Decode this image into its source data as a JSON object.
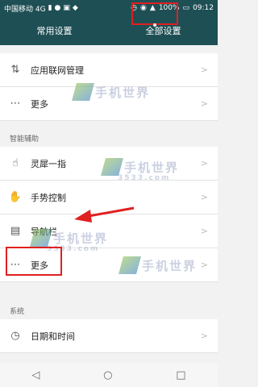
{
  "status": {
    "carrier": "中国移动 4G",
    "battery": "100%",
    "time": "09:12"
  },
  "tabs": [
    {
      "label": "常用设置",
      "active": false
    },
    {
      "label": "全部设置",
      "active": true
    }
  ],
  "rows": {
    "network_mgmt": "应用联网管理",
    "more1": "更多",
    "section_smart": "智能辅助",
    "knuckle": "灵犀一指",
    "gesture": "手势控制",
    "navbar": "导航栏",
    "more2": "更多",
    "section_system": "系统",
    "datetime": "日期和时间"
  },
  "watermark": {
    "text": "手机世界",
    "sub": "3533.com"
  },
  "colors": {
    "header_bg": "#1e4f55",
    "highlight_red": "#e02020"
  },
  "icons": {
    "network": "network-icon",
    "more": "more-dots-icon",
    "knuckle": "knuckle-icon",
    "gesture": "hand-gesture-icon",
    "navbar": "navigation-bar-icon",
    "datetime": "clock-icon"
  }
}
